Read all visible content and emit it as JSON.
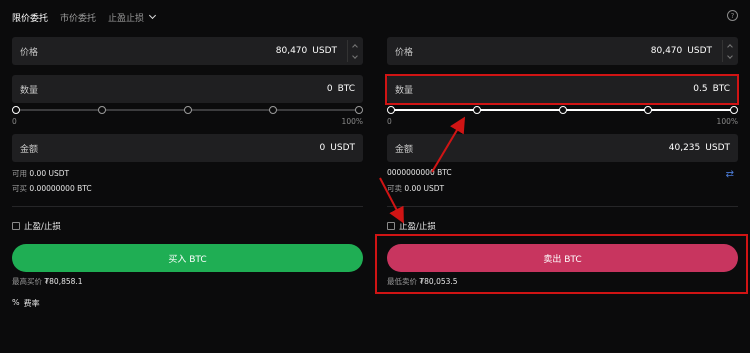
{
  "tabs": [
    {
      "label": "限价委托"
    },
    {
      "label": "市价委托"
    },
    {
      "label": "止盈止损"
    }
  ],
  "help_icon": "question-circle-icon",
  "buy": {
    "price": {
      "label": "价格",
      "value": "80,470",
      "unit": "USDT"
    },
    "quantity": {
      "label": "数量",
      "value": "0",
      "unit": "BTC"
    },
    "slider": {
      "min_label": "0",
      "max_label": "100%",
      "percent": 0
    },
    "amount": {
      "label": "金额",
      "value": "0",
      "unit": "USDT"
    },
    "available": {
      "label": "可用",
      "value": "0.00 USDT"
    },
    "can_buy": {
      "label": "可买",
      "value": "0.00000000 BTC"
    },
    "tpsl_label": "止盈/止损",
    "button": "买入 BTC",
    "best_price": {
      "label": "最高买价",
      "value": "₮80,858.1"
    },
    "fee": {
      "icon": "%",
      "label": "费率"
    }
  },
  "sell": {
    "price": {
      "label": "价格",
      "value": "80,470",
      "unit": "USDT"
    },
    "quantity": {
      "label": "数量",
      "value": "0.5",
      "unit": "BTC"
    },
    "slider": {
      "min_label": "0",
      "max_label": "100%",
      "percent": 100
    },
    "amount": {
      "label": "金额",
      "value": "40,235",
      "unit": "USDT"
    },
    "available": {
      "label": "",
      "value": "0000000000 BTC"
    },
    "can_sell": {
      "label": "可卖",
      "value": "0.00 USDT"
    },
    "tpsl_label": "止盈/止损",
    "button": "卖出 BTC",
    "best_price": {
      "label": "最低卖价",
      "value": "₮80,053.5"
    }
  },
  "colors": {
    "buy": "#1fae54",
    "sell": "#c8355f",
    "highlight": "#d01414",
    "background": "#0b0b0c",
    "field": "#1f1f21"
  }
}
